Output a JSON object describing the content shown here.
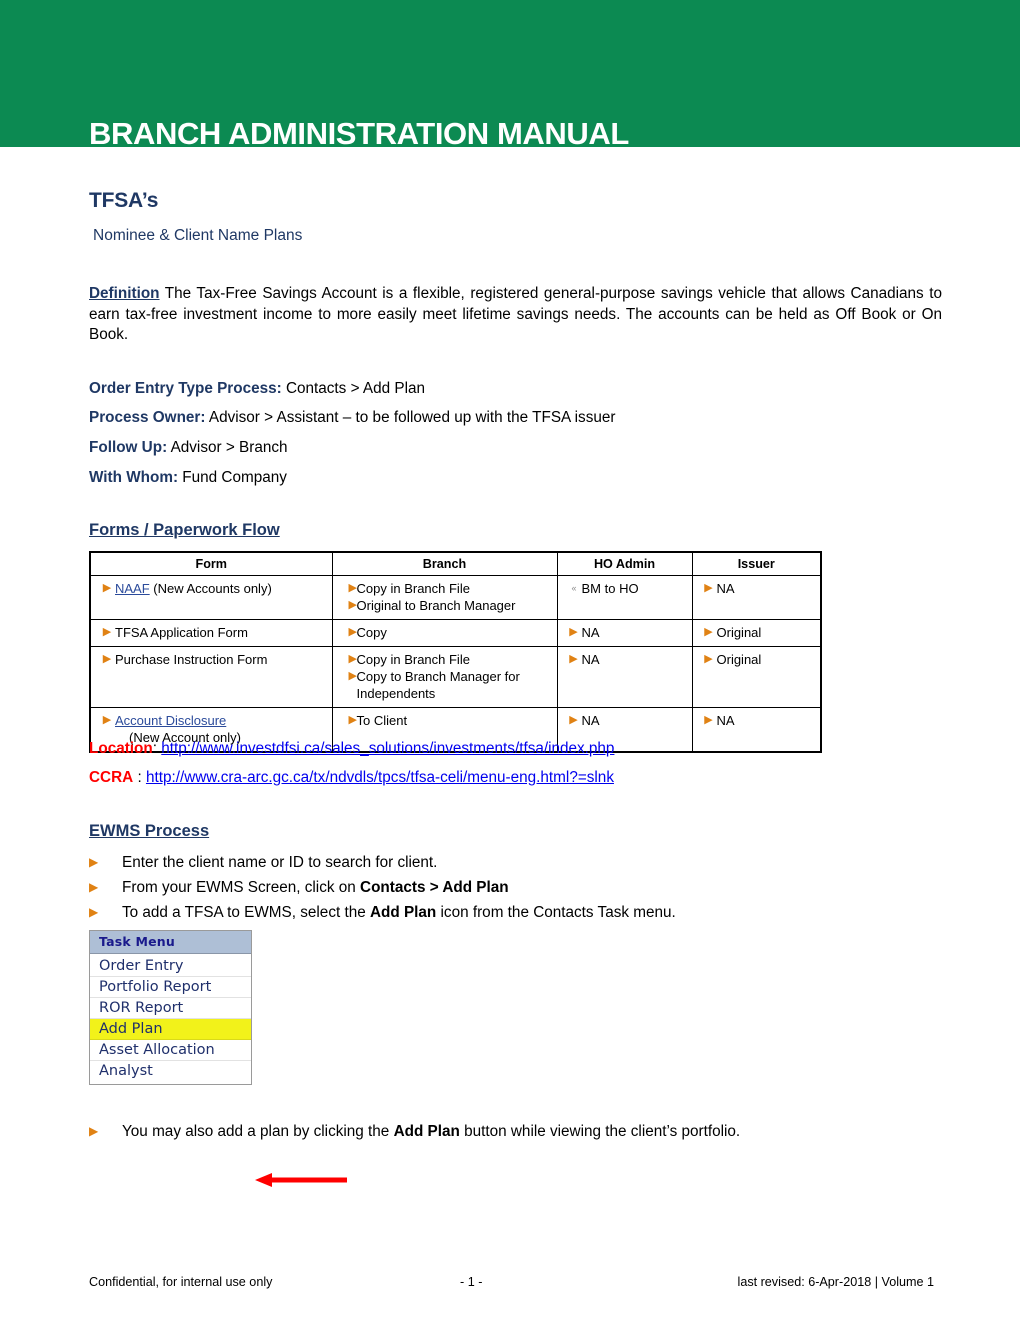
{
  "banner": {
    "title": "BRANCH ADMINISTRATION MANUAL",
    "color": "#0c8a52"
  },
  "document": {
    "title": "TFSA’s",
    "subtitle": "Nominee & Client Name Plans"
  },
  "definition": {
    "label": "Definition",
    "text": " The Tax-Free Savings Account is a flexible, registered general-purpose savings vehicle that allows Canadians to earn tax-free investment income to more easily meet lifetime savings needs.  The accounts can be held as Off Book or On Book."
  },
  "process": [
    {
      "key": "Order Entry Type Process:",
      "value": " Contacts > Add Plan"
    },
    {
      "key": "Process Owner:",
      "value": "  Advisor > Assistant – to be followed up with the TFSA issuer"
    },
    {
      "key": "Follow Up:",
      "value": "  Advisor > Branch"
    },
    {
      "key": "With Whom:",
      "value": " Fund Company"
    }
  ],
  "sections": {
    "forms_heading": "Forms / Paperwork Flow ",
    "ewms_heading": "EWMS Process"
  },
  "forms_table": {
    "headers": [
      "Form",
      "Branch",
      "HO Admin",
      "Issuer"
    ],
    "rows": [
      {
        "form": {
          "link": "NAAF",
          "rest": " (New Accounts only)"
        },
        "branch": [
          "Copy in Branch File",
          "Original to Branch Manager"
        ],
        "ho_admin": [
          "BM to HO"
        ],
        "issuer": [
          "NA"
        ]
      },
      {
        "form": {
          "link": "",
          "rest": "TFSA Application Form"
        },
        "branch": [
          "Copy"
        ],
        "ho_admin": [
          "NA"
        ],
        "issuer": [
          "Original"
        ]
      },
      {
        "form": {
          "link": "",
          "rest": "Purchase Instruction Form"
        },
        "branch": [
          "Copy in Branch File",
          "Copy to Branch Manager for Independents"
        ],
        "ho_admin": [
          "NA"
        ],
        "issuer": [
          "Original"
        ]
      },
      {
        "form": {
          "link": "Account Disclosure",
          "rest": "",
          "second_line": "(New Account only)"
        },
        "branch": [
          "To Client"
        ],
        "ho_admin": [
          "NA"
        ],
        "issuer": [
          "NA"
        ]
      }
    ]
  },
  "links": {
    "location_label": "Location",
    "location_sep": ": ",
    "location_url": "http://www.investdfsi.ca/sales_solutions/investments/tfsa/index.php",
    "ccra_label": "CCRA",
    "ccra_sep": " : ",
    "ccra_url": "http://www.cra-arc.gc.ca/tx/ndvdls/tpcs/tfsa-celi/menu-eng.html?=slnk"
  },
  "ewms_bullets": [
    {
      "pre": "Enter the client name or ID to search for client.",
      "bold": "",
      "post": ""
    },
    {
      "pre": "From your EWMS Screen, click on ",
      "bold": "Contacts > Add Plan",
      "post": ""
    },
    {
      "pre": "To add a TFSA to EWMS, select the ",
      "bold": "Add Plan",
      "post": " icon from the Contacts Task menu."
    }
  ],
  "last_bullet": {
    "pre": "You may also add a plan by clicking the ",
    "bold": "Add Plan",
    "post": " button while viewing the client’s portfolio."
  },
  "task_menu": {
    "header": "Task Menu",
    "items": [
      "Order Entry",
      "Portfolio Report",
      "ROR Report",
      "Add Plan",
      "Asset Allocation",
      "Analyst"
    ],
    "highlighted": "Add Plan",
    "highlight_color": "#f2f21a",
    "arrow_color": "#ff0000"
  },
  "footer": {
    "left": "Confidential, for internal use only",
    "center": "- 1 -",
    "right": "last revised: 6-Apr-2018 | Volume 1"
  }
}
